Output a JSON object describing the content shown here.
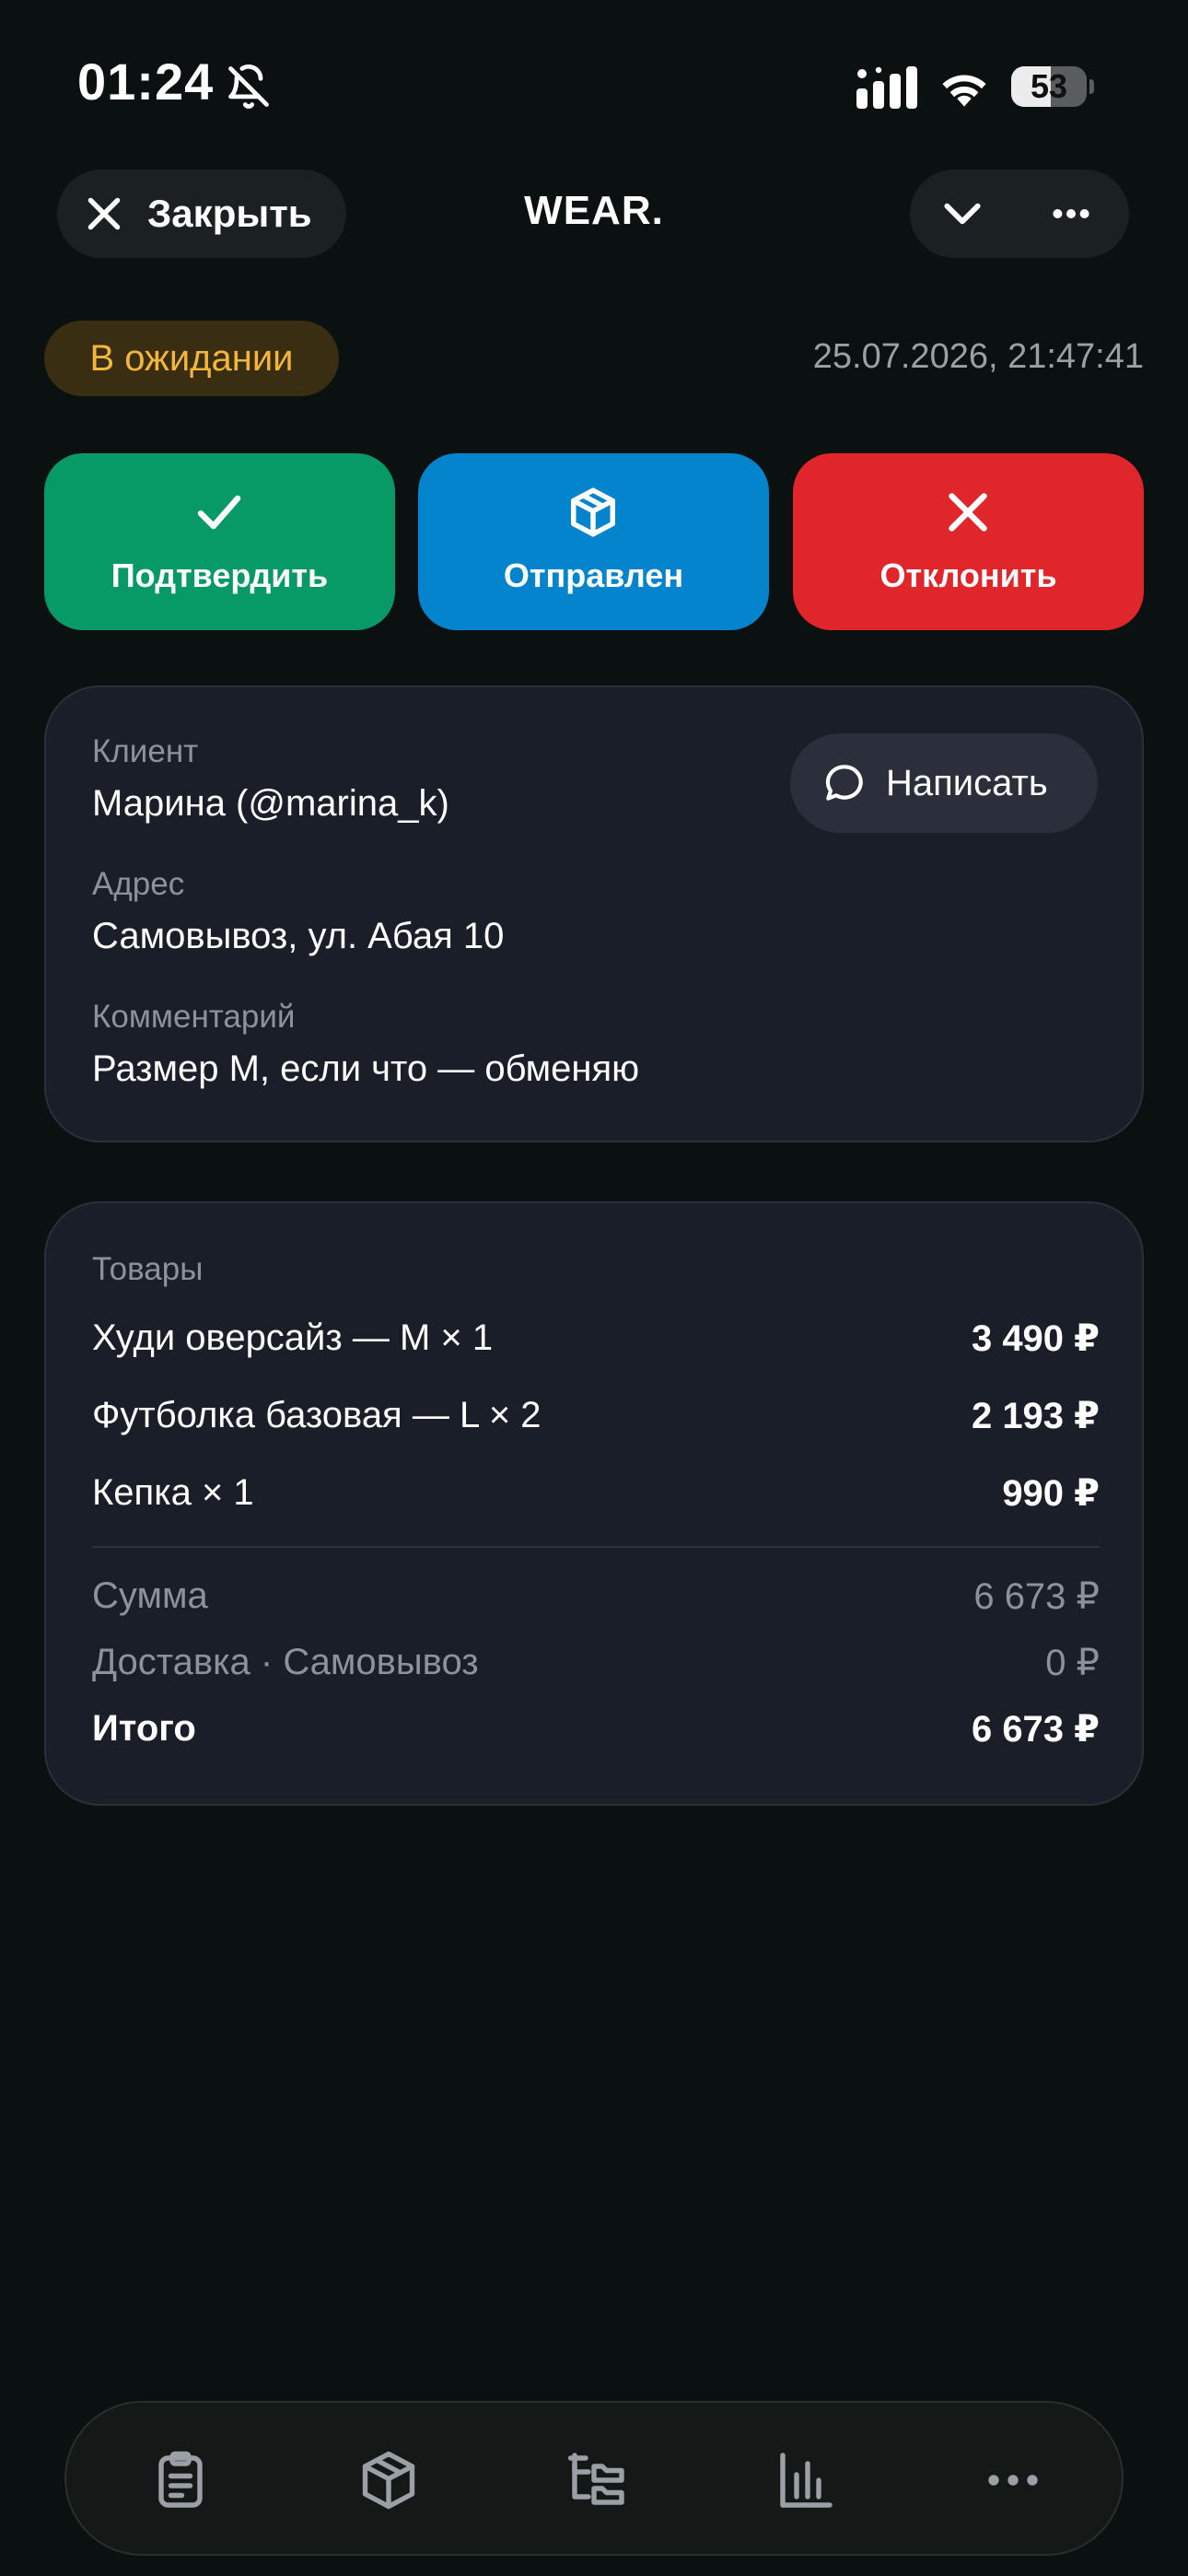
{
  "status_bar": {
    "time": "01:24",
    "battery_text": "53",
    "battery_level": 0.53,
    "icons": [
      "bell-off-icon",
      "signal-icon",
      "wifi-icon",
      "battery-icon"
    ]
  },
  "header": {
    "close_label": "Закрыть",
    "brand": "WEAR.",
    "icons": [
      "close-icon",
      "chevron-down-icon",
      "more-horizontal-icon"
    ]
  },
  "order": {
    "status": "В ожидании",
    "status_color": "#f4b63a",
    "datetime": "25.07.2026, 21:47:41"
  },
  "actions": [
    {
      "label": "Подтвердить",
      "icon": "check-icon",
      "color": "#079a66"
    },
    {
      "label": "Отправлен",
      "icon": "box-icon",
      "color": "#0584ce"
    },
    {
      "label": "Отклонить",
      "icon": "close-icon",
      "color": "#e0262a"
    }
  ],
  "client": {
    "client_label": "Клиент",
    "client_value": "Марина (@marina_k)",
    "message_label": "Написать",
    "address_label": "Адрес",
    "address_value": "Самовывоз, ул. Абая 10",
    "comment_label": "Комментарий",
    "comment_value": "Размер M, если что — обменяю"
  },
  "goods": {
    "title": "Товары",
    "items": [
      {
        "name": "Худи оверсайз — M × 1",
        "price": "3 490 ₽"
      },
      {
        "name": "Футболка базовая — L × 2",
        "price": "2 193 ₽"
      },
      {
        "name": "Кепка × 1",
        "price": "990 ₽"
      }
    ],
    "summary": [
      {
        "name": "Сумма",
        "price": "6 673 ₽"
      },
      {
        "name": "Доставка · Самовывоз",
        "price": "0 ₽"
      }
    ],
    "total": {
      "name": "Итого",
      "price": "6 673 ₽"
    }
  },
  "tabbar": {
    "tabs": [
      "orders-icon",
      "products-icon",
      "categories-icon",
      "stats-icon",
      "more-icon"
    ]
  },
  "colors": {
    "background": "#0b1110",
    "card": "#1a1e29",
    "muted": "#8c929b"
  }
}
